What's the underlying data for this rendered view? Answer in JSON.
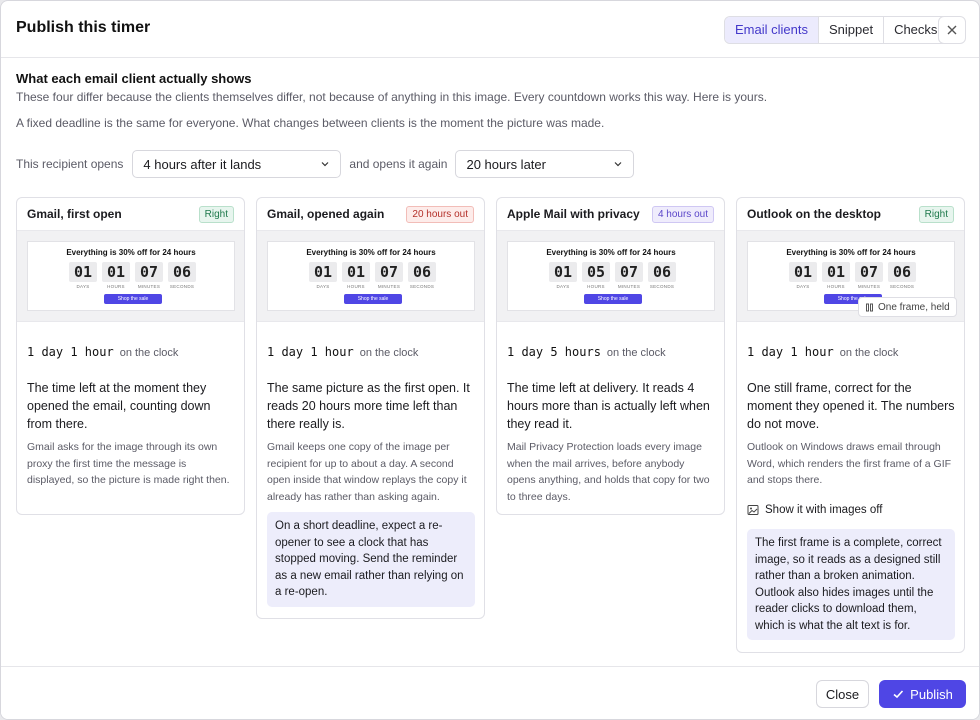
{
  "dialog": {
    "title": "Publish this timer",
    "tabs": [
      {
        "label": "Email clients",
        "active": true
      },
      {
        "label": "Snippet",
        "active": false
      },
      {
        "label": "Checks",
        "active": false
      }
    ]
  },
  "section": {
    "title": "What each email client actually shows",
    "subtitle": "These four differ because the clients themselves differ, not because of anything in this image. Every countdown works this way. Here is yours.",
    "note": "A fixed deadline is the same for everyone. What changes between clients is the moment the picture was made."
  },
  "controls": {
    "opens_label": "This recipient opens",
    "opens_value": "4 hours after it lands",
    "again_label": "and opens it again",
    "again_value": "20 hours later"
  },
  "preview": {
    "headline": "Everything is 30% off for 24 hours",
    "units": [
      "DAYS",
      "HOURS",
      "MINUTES",
      "SECONDS"
    ],
    "cta": "Shop the sale"
  },
  "clients": [
    {
      "name": "Gmail, first open",
      "badge": "Right",
      "badge_tone": "right",
      "digits": [
        "01",
        "01",
        "07",
        "06"
      ],
      "clock": "1 day 1 hour",
      "clock_suffix": "on the clock",
      "description": "The time left at the moment they opened the email, counting down from there.",
      "detail": "Gmail asks for the image through its own proxy the first time the message is displayed, so the picture is made right then."
    },
    {
      "name": "Gmail, opened again",
      "badge": "20 hours out",
      "badge_tone": "red",
      "digits": [
        "01",
        "01",
        "07",
        "06"
      ],
      "clock": "1 day 1 hour",
      "clock_suffix": "on the clock",
      "description": "The same picture as the first open. It reads 20 hours more time left than there really is.",
      "detail": "Gmail keeps one copy of the image per recipient for up to about a day. A second open inside that window replays the copy it already has rather than asking again.",
      "callout": "On a short deadline, expect a re-opener to see a clock that has stopped moving. Send the reminder as a new email rather than relying on a re-open."
    },
    {
      "name": "Apple Mail with privacy",
      "badge": "4 hours out",
      "badge_tone": "purple",
      "digits": [
        "01",
        "05",
        "07",
        "06"
      ],
      "clock": "1 day 5 hours",
      "clock_suffix": "on the clock",
      "description": "The time left at delivery. It reads 4 hours more than is actually left when they read it.",
      "detail": "Mail Privacy Protection loads every image when the mail arrives, before anybody opens anything, and holds that copy for two to three days."
    },
    {
      "name": "Outlook on the desktop",
      "badge": "Right",
      "badge_tone": "right",
      "digits": [
        "01",
        "01",
        "07",
        "06"
      ],
      "frame_chip": "One frame, held",
      "clock": "1 day 1 hour",
      "clock_suffix": "on the clock",
      "description": "One still frame, correct for the moment they opened it. The numbers do not move.",
      "detail": "Outlook on Windows draws email through Word, which renders the first frame of a GIF and stops there.",
      "show_images_off": "Show it with images off",
      "callout": "The first frame is a complete, correct image, so it reads as a designed still rather than a broken animation. Outlook also hides images until the reader clicks to download them, which is what the alt text is for."
    }
  ],
  "footer": {
    "close_label": "Close",
    "publish_label": "Publish"
  }
}
